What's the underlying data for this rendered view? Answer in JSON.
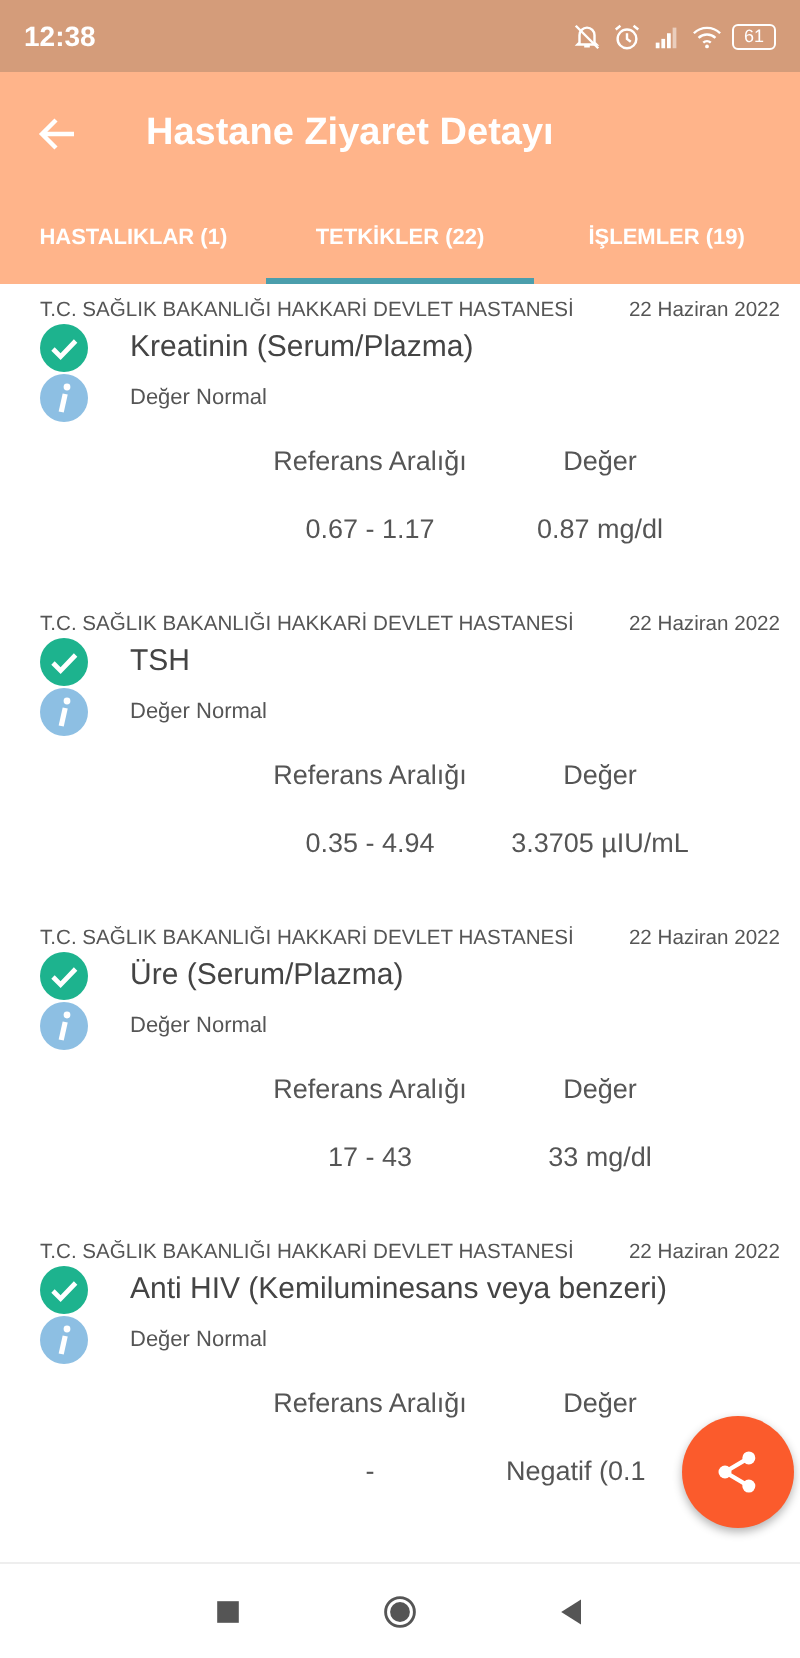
{
  "status_bar": {
    "time": "12:38",
    "battery": "61"
  },
  "header": {
    "title": "Hastane Ziyaret Detayı"
  },
  "tabs": [
    {
      "label": "HASTALIKLAR (1)",
      "selected": false
    },
    {
      "label": "TETKİKLER (22)",
      "selected": true
    },
    {
      "label": "İŞLEMLER (19)",
      "selected": false
    }
  ],
  "results": [
    {
      "hospital": "T.C. SAĞLIK BAKANLIĞI HAKKARİ DEVLET HASTANESİ",
      "date": "22 Haziran 2022",
      "test": "Kreatinin (Serum/Plazma)",
      "kind": "normal",
      "note": "Değer Normal",
      "range_label": "Referans Aralığı",
      "value_label": "Değer",
      "range": "0.67 - 1.17",
      "value": "0.87 mg/dl"
    },
    {
      "hospital": "T.C. SAĞLIK BAKANLIĞI HAKKARİ DEVLET HASTANESİ",
      "date": "22 Haziran 2022",
      "test": "TSH",
      "kind": "normal",
      "note": "Değer Normal",
      "range_label": "Referans Aralığı",
      "value_label": "Değer",
      "range": "0.35 - 4.94",
      "value": "3.3705 µIU/mL"
    },
    {
      "hospital": "T.C. SAĞLIK BAKANLIĞI HAKKARİ DEVLET HASTANESİ",
      "date": "22 Haziran 2022",
      "test": "Üre (Serum/Plazma)",
      "kind": "normal",
      "note": "Değer Normal",
      "range_label": "Referans Aralığı",
      "value_label": "Değer",
      "range": "17 - 43",
      "value": "33 mg/dl"
    },
    {
      "hospital": "T.C. SAĞLIK BAKANLIĞI HAKKARİ DEVLET HASTANESİ",
      "date": "22 Haziran 2022",
      "test": "Anti HIV (Kemiluminesans veya benzeri)",
      "kind": "normal",
      "note": "Değer Normal",
      "range_label": "Referans Aralığı",
      "value_label": "Değer",
      "range": "-",
      "value": "Negatif (0.1"
    }
  ]
}
